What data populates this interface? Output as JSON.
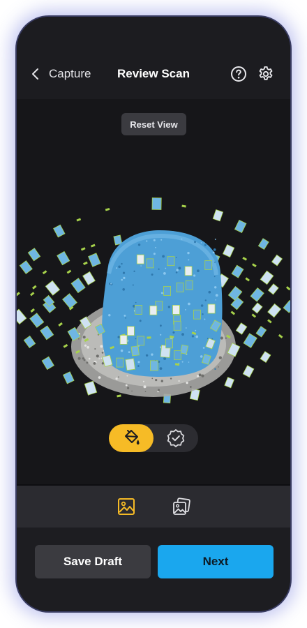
{
  "header": {
    "back_label": "Capture",
    "title": "Review Scan",
    "icons": [
      "chevron-left-icon",
      "help-circle-icon",
      "gear-icon"
    ]
  },
  "viewport": {
    "reset_label": "Reset View",
    "object_color": "#4d9fd6",
    "ground_color": "#b9b9b6",
    "camera_frame_color": "#a7d24b"
  },
  "mode_toggle": {
    "options": [
      "paint-bucket-icon",
      "verified-badge-icon"
    ],
    "active": "paint-bucket-icon",
    "active_color": "#f6bb26"
  },
  "tabbar": {
    "tabs": [
      "image-icon",
      "image-stack-icon"
    ],
    "active": "image-icon",
    "active_color": "#f6bb26"
  },
  "footer": {
    "save_draft_label": "Save Draft",
    "next_label": "Next",
    "next_color": "#1aa7ee"
  }
}
